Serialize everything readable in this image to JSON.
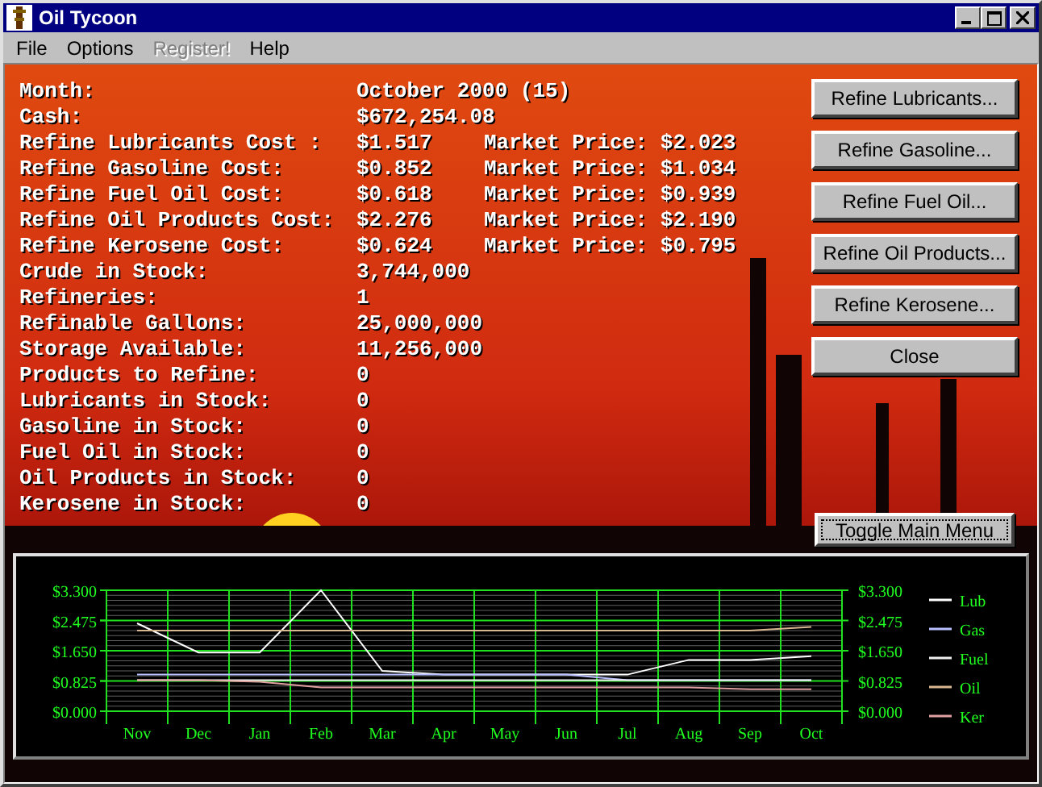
{
  "window": {
    "title": "Oil Tycoon"
  },
  "menu": [
    {
      "label": "File",
      "disabled": false
    },
    {
      "label": "Options",
      "disabled": false
    },
    {
      "label": "Register!",
      "disabled": true
    },
    {
      "label": "Help",
      "disabled": false
    }
  ],
  "stats": [
    {
      "label": "Month:",
      "value": "October 2000 (15)"
    },
    {
      "label": "Cash:",
      "value": "$672,254.08"
    },
    {
      "label": "Refine Lubricants Cost :",
      "value": "$1.517",
      "market_label": "Market Price:",
      "market_price": "$2.023"
    },
    {
      "label": "Refine Gasoline Cost:",
      "value": "$0.852",
      "market_label": "Market Price:",
      "market_price": "$1.034"
    },
    {
      "label": "Refine Fuel Oil Cost:",
      "value": "$0.618",
      "market_label": "Market Price:",
      "market_price": "$0.939"
    },
    {
      "label": "Refine Oil Products Cost:",
      "value": "$2.276",
      "market_label": "Market Price:",
      "market_price": "$2.190"
    },
    {
      "label": "Refine Kerosene Cost:",
      "value": "$0.624",
      "market_label": "Market Price:",
      "market_price": "$0.795"
    },
    {
      "label": "Crude in Stock:",
      "value": "3,744,000"
    },
    {
      "label": "Refineries:",
      "value": "1"
    },
    {
      "label": "Refinable Gallons:",
      "value": "25,000,000"
    },
    {
      "label": "Storage Available:",
      "value": "11,256,000"
    },
    {
      "label": "Products to Refine:",
      "value": "0"
    },
    {
      "label": "Lubricants in Stock:",
      "value": "0"
    },
    {
      "label": "Gasoline in Stock:",
      "value": "0"
    },
    {
      "label": "Fuel Oil in Stock:",
      "value": "0"
    },
    {
      "label": "Oil Products in Stock:",
      "value": "0"
    },
    {
      "label": "Kerosene in Stock:",
      "value": "0"
    }
  ],
  "buttons": [
    "Refine Lubricants...",
    "Refine Gasoline...",
    "Refine Fuel Oil...",
    "Refine Oil Products...",
    "Refine Kerosene...",
    "Close"
  ],
  "toggle_button": {
    "label": "Toggle Main Menu",
    "focused": true
  },
  "chart": {
    "chart_data": {
      "type": "line",
      "categories": [
        "Nov",
        "Dec",
        "Jan",
        "Feb",
        "Mar",
        "Apr",
        "May",
        "Jun",
        "Jul",
        "Aug",
        "Sep",
        "Oct"
      ],
      "yticks": [
        {
          "value": 0,
          "label": "$0.000"
        },
        {
          "value": 0.825,
          "label": "$0.825"
        },
        {
          "value": 1.65,
          "label": "$1.650"
        },
        {
          "value": 2.475,
          "label": "$2.475"
        },
        {
          "value": 3.3,
          "label": "$3.300"
        }
      ],
      "ylim": [
        0,
        3.3
      ],
      "grid": true,
      "legend": true,
      "series": [
        {
          "name": "Lub",
          "color": "#ffffff",
          "values": [
            2.4,
            1.6,
            1.6,
            3.3,
            1.1,
            1.0,
            1.0,
            1.0,
            1.0,
            1.4,
            1.4,
            1.5
          ]
        },
        {
          "name": "Gas",
          "color": "#b8c0ff",
          "values": [
            1.0,
            1.0,
            1.0,
            1.0,
            1.0,
            1.0,
            1.0,
            1.0,
            0.85,
            0.85,
            0.85,
            0.85
          ]
        },
        {
          "name": "Fuel",
          "color": "#f0f0f0",
          "values": [
            0.85,
            0.85,
            0.85,
            0.85,
            0.85,
            0.85,
            0.85,
            0.85,
            0.85,
            0.85,
            0.85,
            0.85
          ]
        },
        {
          "name": "Oil",
          "color": "#d8b890",
          "values": [
            2.2,
            2.2,
            2.2,
            2.2,
            2.2,
            2.2,
            2.2,
            2.2,
            2.2,
            2.2,
            2.2,
            2.3
          ]
        },
        {
          "name": "Ker",
          "color": "#e0a0a0",
          "values": [
            0.85,
            0.85,
            0.8,
            0.65,
            0.65,
            0.65,
            0.65,
            0.65,
            0.65,
            0.65,
            0.6,
            0.6
          ]
        }
      ]
    }
  }
}
